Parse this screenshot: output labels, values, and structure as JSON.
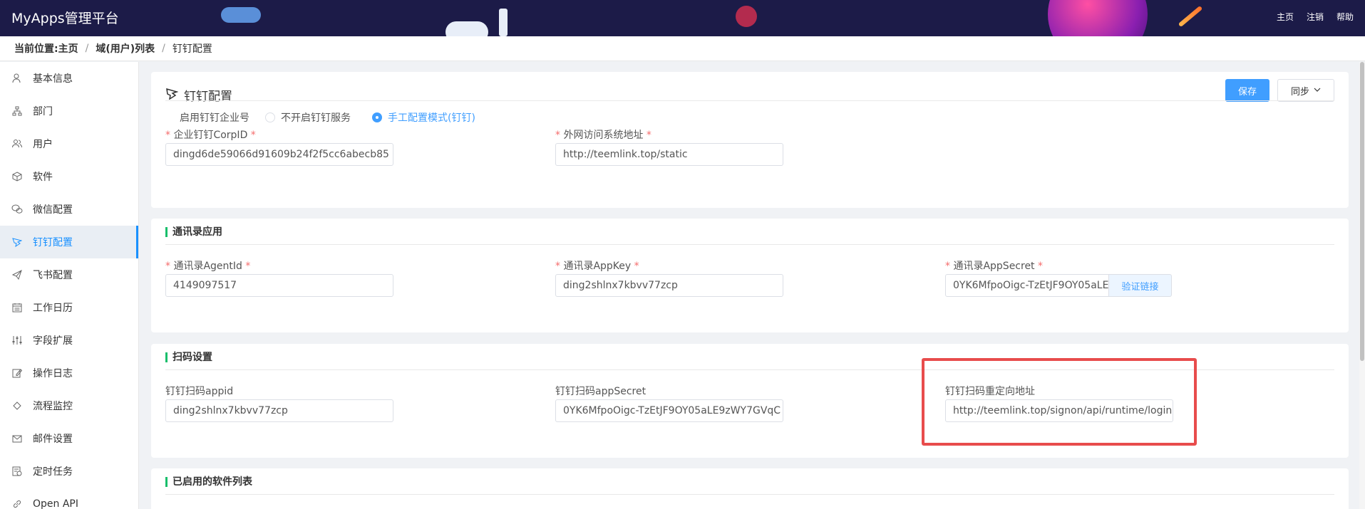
{
  "header": {
    "app_title": "MyApps管理平台",
    "nav": [
      "主页",
      "注销",
      "帮助"
    ]
  },
  "breadcrumb": {
    "prefix": "当前位置:",
    "items": [
      "主页",
      "域(用户)列表",
      "钉钉配置"
    ]
  },
  "sidebar": {
    "items": [
      {
        "label": "基本信息",
        "icon": "user-icon"
      },
      {
        "label": "部门",
        "icon": "org-icon"
      },
      {
        "label": "用户",
        "icon": "users-icon"
      },
      {
        "label": "软件",
        "icon": "cube-icon"
      },
      {
        "label": "微信配置",
        "icon": "wechat-icon"
      },
      {
        "label": "钉钉配置",
        "icon": "dingtalk-icon",
        "active": true
      },
      {
        "label": "飞书配置",
        "icon": "paper-plane-icon"
      },
      {
        "label": "工作日历",
        "icon": "calendar-icon"
      },
      {
        "label": "字段扩展",
        "icon": "sliders-icon"
      },
      {
        "label": "操作日志",
        "icon": "edit-log-icon"
      },
      {
        "label": "流程监控",
        "icon": "flow-icon"
      },
      {
        "label": "邮件设置",
        "icon": "mail-icon"
      },
      {
        "label": "定时任务",
        "icon": "timer-icon"
      },
      {
        "label": "Open API",
        "icon": "link-icon"
      }
    ]
  },
  "config_card": {
    "title": "钉钉配置",
    "save_label": "保存",
    "sync_label": "同步",
    "enable_label": "启用钉钉企业号",
    "radio_off": "不开启钉钉服务",
    "radio_manual": "手工配置模式(钉钉)",
    "corpid_label": "企业钉钉CorpID",
    "corpid_value": "dingd6de59066d91609b24f2f5cc6abecb85",
    "url_label": "外网访问系统地址",
    "url_value": "http://teemlink.top/static"
  },
  "contacts_card": {
    "title": "通讯录应用",
    "agentid_label": "通讯录AgentId",
    "agentid_value": "4149097517",
    "appkey_label": "通讯录AppKey",
    "appkey_value": "ding2shlnx7kbvv77zcp",
    "appsecret_label": "通讯录AppSecret",
    "appsecret_value": "0YK6MfpoOigc-TzEtJF9OY05aLE",
    "verify_label": "验证链接"
  },
  "scan_card": {
    "title": "扫码设置",
    "appid_label": "钉钉扫码appid",
    "appid_value": "ding2shlnx7kbvv77zcp",
    "secret_label": "钉钉扫码appSecret",
    "secret_value": "0YK6MfpoOigc-TzEtJF9OY05aLE9zWY7GVqC",
    "redirect_label": "钉钉扫码重定向地址",
    "redirect_value": "http://teemlink.top/signon/api/runtime/login"
  },
  "software_card": {
    "title": "已启用的软件列表"
  },
  "colors": {
    "header_bg": "#1c1b48",
    "accent": "#409eff",
    "required": "#f56c6c",
    "section_bar": "#19be6b",
    "highlight": "#e84c4c"
  }
}
